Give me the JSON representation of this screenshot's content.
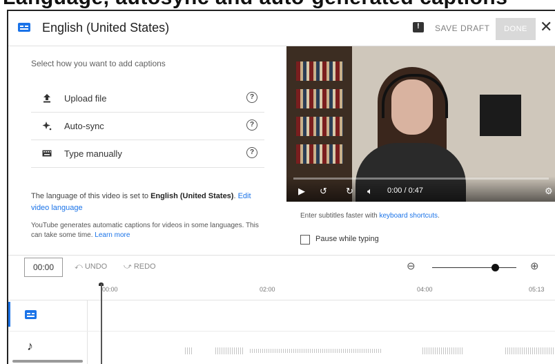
{
  "banner": {
    "text": "Language, autosync and auto-generated captions"
  },
  "header": {
    "title": "English (United States)",
    "save_draft": "SAVE DRAFT",
    "done": "DONE",
    "close": "✕",
    "icons": [
      "subtitles-icon",
      "feedback-icon",
      "close-icon"
    ]
  },
  "options": {
    "prompt": "Select how you want to add captions",
    "items": [
      {
        "label": "Upload file",
        "icon": "upload-icon"
      },
      {
        "label": "Auto-sync",
        "icon": "sparkle-icon"
      },
      {
        "label": "Type manually",
        "icon": "keyboard-icon"
      }
    ],
    "help": "?"
  },
  "info": {
    "lang_prefix": "The language of this video is set to ",
    "lang_name": "English (United States)",
    "lang_suffix": ". ",
    "edit_link": "Edit video language",
    "auto_text": "YouTube generates automatic captions for videos in some languages. This can take some time. ",
    "learn_more": "Learn more"
  },
  "video": {
    "time": "0:00 / 0:47",
    "progress": 0
  },
  "typing": {
    "shortcut_prefix": "Enter subtitles faster with ",
    "shortcut_link": "keyboard shortcuts",
    "shortcut_suffix": ".",
    "pause_label": "Pause while typing",
    "pause_checked": false
  },
  "timeline": {
    "current_time": "00:00",
    "undo": "UNDO",
    "redo": "REDO",
    "ticks": [
      "00:00",
      "02:00",
      "04:00",
      "05:13"
    ],
    "zoom_level": 0.7
  },
  "colors": {
    "accent": "#1a73e8",
    "done_disabled": "#d9d9d9"
  }
}
